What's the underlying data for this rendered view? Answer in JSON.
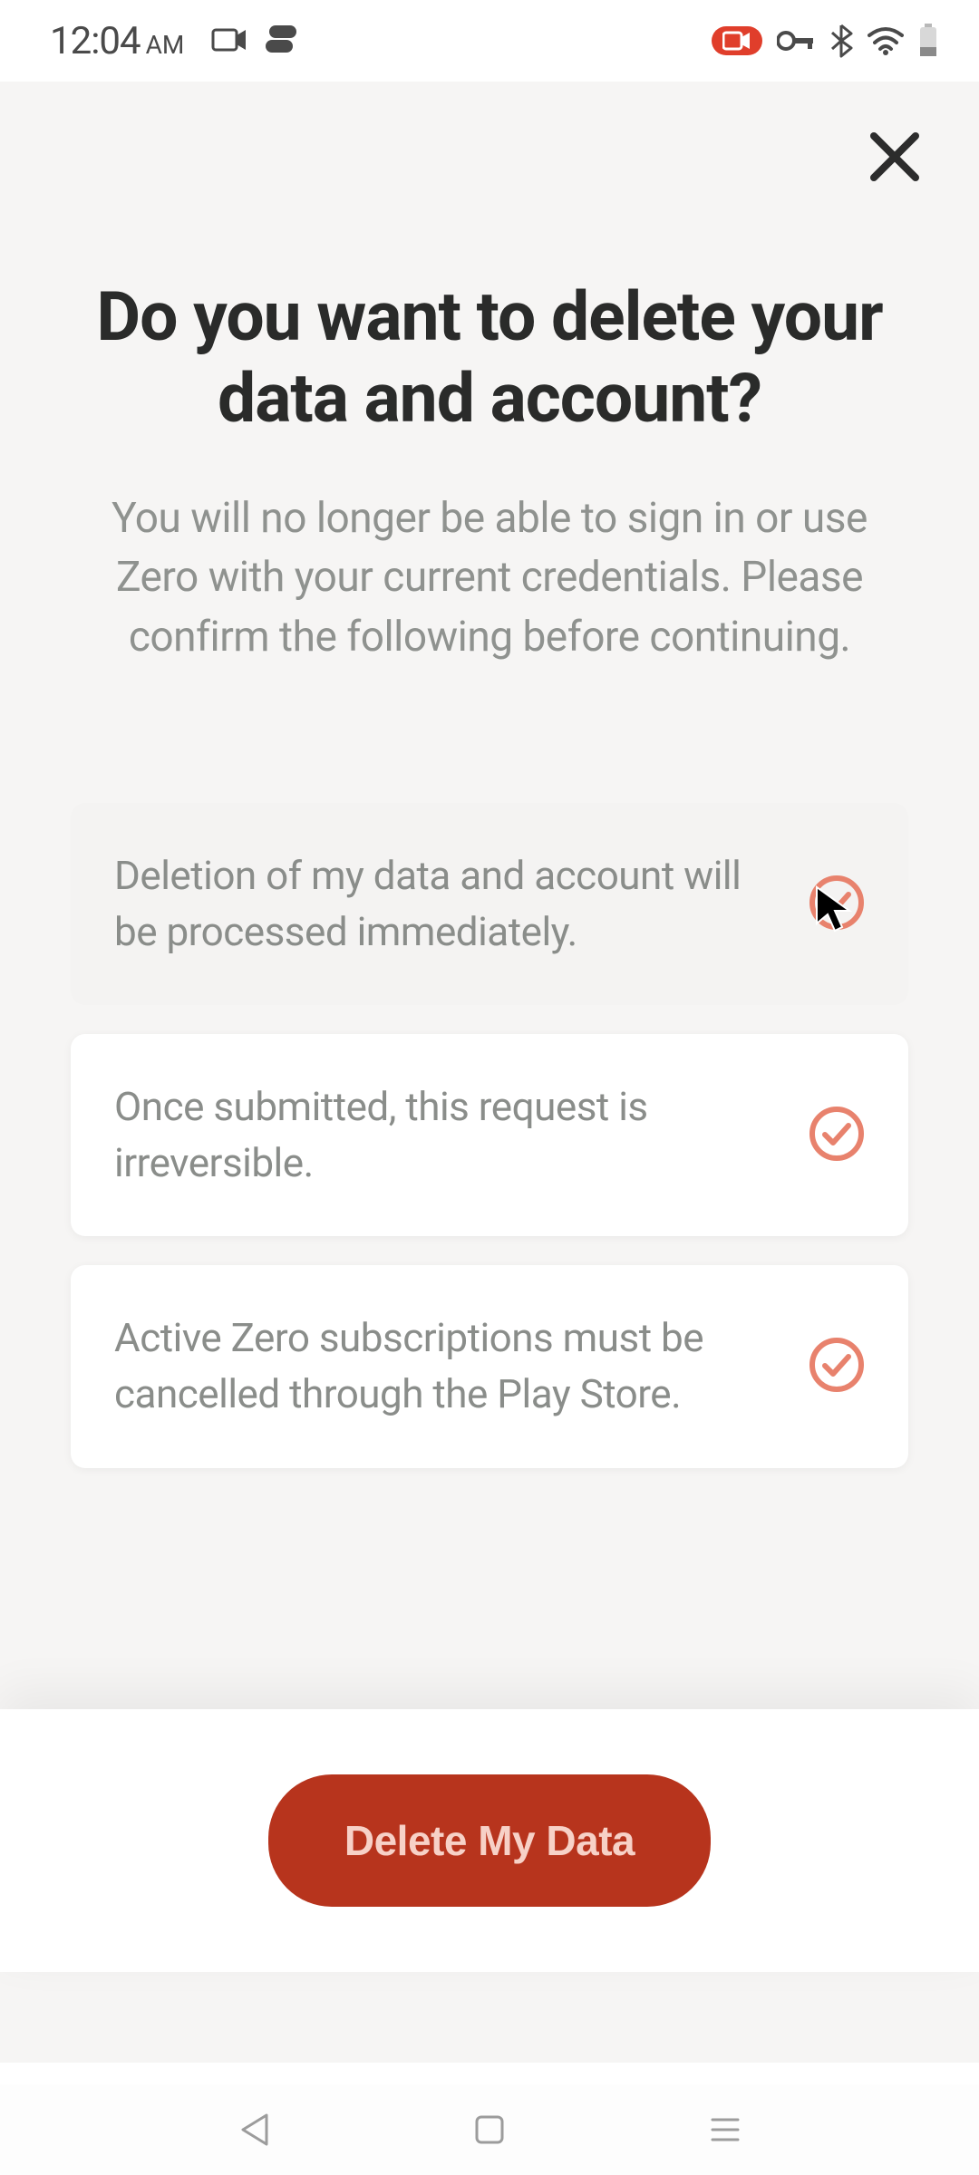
{
  "status_bar": {
    "time": "12:04",
    "ampm": "AM"
  },
  "screen": {
    "title": "Do you want to delete your data and account?",
    "subtitle": "You will no longer be able to sign in or use Zero with your current credentials. Please confirm the following before continuing.",
    "acknowledgements": [
      {
        "text": "Deletion of my data and account will be processed immediately.",
        "checked": true
      },
      {
        "text": "Once submitted, this request is irreversible.",
        "checked": true
      },
      {
        "text": "Active Zero subscriptions must be cancelled through the Play Store.",
        "checked": true
      }
    ],
    "primary_action_label": "Delete My Data",
    "accent_color": "#e36a54",
    "primary_button_color": "#b7341d"
  }
}
